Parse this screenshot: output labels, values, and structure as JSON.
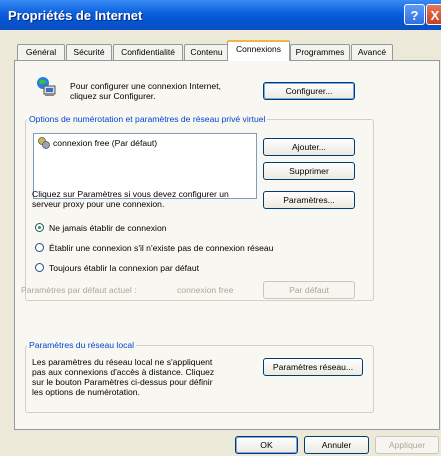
{
  "window": {
    "title": "Propriétés de Internet",
    "help_icon_glyph": "?",
    "close_icon_glyph": "X"
  },
  "tabs": [
    {
      "label": "Général"
    },
    {
      "label": "Sécurité"
    },
    {
      "label": "Confidentialité"
    },
    {
      "label": "Contenu"
    },
    {
      "label": "Connexions"
    },
    {
      "label": "Programmes"
    },
    {
      "label": "Avancé"
    }
  ],
  "active_tab": "Connexions",
  "setup": {
    "line1": "Pour configurer une connexion Internet,",
    "line2": "cliquez sur Configurer.",
    "button": "Configurer..."
  },
  "dialup": {
    "group_label": "Options de numérotation et paramètres de réseau privé virtuel",
    "connections": [
      "connexion free (Par défaut)"
    ],
    "add_button": "Ajouter...",
    "remove_button": "Supprimer",
    "proxy_line1": "Cliquez sur Paramètres si vous devez configurer un",
    "proxy_line2": "serveur proxy pour une connexion.",
    "settings_button": "Paramètres...",
    "options": [
      {
        "label": "Ne jamais établir de connexion",
        "selected": true
      },
      {
        "label": "Établir une connexion s'il n'existe pas de connexion réseau",
        "selected": false
      },
      {
        "label": "Toujours établir la connexion par défaut",
        "selected": false
      }
    ],
    "current_default_label": "Paramètres par défaut actuel :",
    "current_default_value": "connexion free",
    "set_default_button": "Par défaut"
  },
  "lan": {
    "group_label": "Paramètres du réseau local",
    "line1": "Les paramètres du réseau local ne s'appliquent",
    "line2": "pas aux connexions d'accès à distance. Cliquez",
    "line3": "sur le bouton Paramètres ci-dessus pour définir",
    "line4": "les options de numérotation.",
    "button": "Paramètres réseau..."
  },
  "footer": {
    "ok": "OK",
    "cancel": "Annuler",
    "apply": "Appliquer"
  },
  "colors": {
    "titlebar": "#0a5fdc",
    "group_label": "#0046d5",
    "dialog_bg": "#ece9d8"
  }
}
